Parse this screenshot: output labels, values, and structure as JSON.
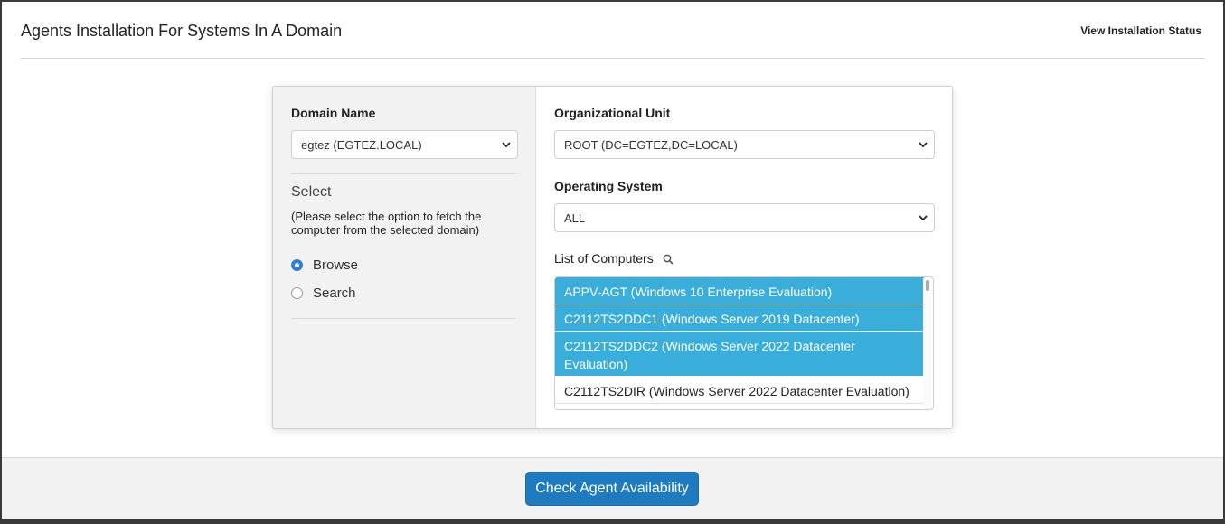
{
  "page": {
    "title": "Agents Installation For Systems In A Domain",
    "status_link": "View Installation Status"
  },
  "left": {
    "domain_label": "Domain Name",
    "domain_value": "egtez (EGTEZ.LOCAL)",
    "select_heading": "Select",
    "hint": "(Please select the option to fetch the computer from the selected domain)",
    "options": [
      {
        "label": "Browse",
        "checked": true
      },
      {
        "label": "Search",
        "checked": false
      }
    ]
  },
  "right": {
    "ou_label": "Organizational Unit",
    "ou_value": "ROOT (DC=EGTEZ,DC=LOCAL)",
    "os_label": "Operating System",
    "os_value": "ALL",
    "computers_label": "List of Computers",
    "computers_icon": "search-icon",
    "computers": [
      {
        "text": "APPV-AGT (Windows 10 Enterprise Evaluation)",
        "selected": true
      },
      {
        "text": "C2112TS2DDC1 (Windows Server 2019 Datacenter)",
        "selected": true
      },
      {
        "text": "C2112TS2DDC2 (Windows Server 2022 Datacenter Evaluation)",
        "selected": true
      },
      {
        "text": "C2112TS2DIR (Windows Server 2022 Datacenter Evaluation)",
        "selected": false
      }
    ]
  },
  "footer": {
    "button_label": "Check Agent Availability"
  },
  "colors": {
    "accent": "#1f7bbf",
    "selection": "#3aaedb",
    "radio": "#2f7ed8"
  }
}
